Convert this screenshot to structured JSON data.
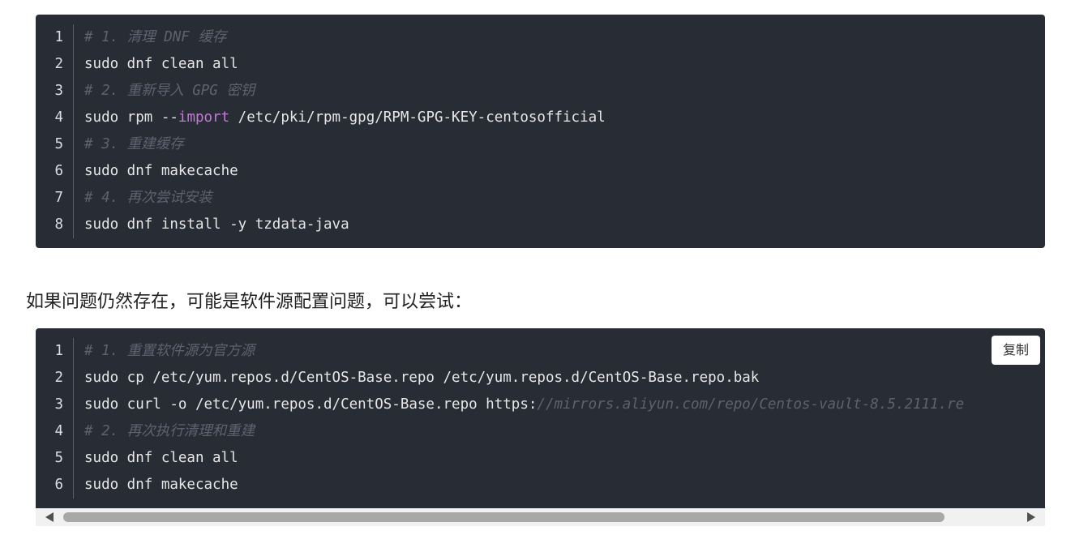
{
  "code_blocks": [
    {
      "lines": [
        {
          "number": "1",
          "parts": [
            {
              "type": "comment",
              "text": "# 1. 清理 DNF 缓存"
            }
          ]
        },
        {
          "number": "2",
          "parts": [
            {
              "type": "plain",
              "text": "sudo dnf clean all"
            }
          ]
        },
        {
          "number": "3",
          "parts": [
            {
              "type": "comment",
              "text": "# 2. 重新导入 GPG 密钥"
            }
          ]
        },
        {
          "number": "4",
          "parts": [
            {
              "type": "plain",
              "text": "sudo rpm --"
            },
            {
              "type": "keyword",
              "text": "import"
            },
            {
              "type": "plain",
              "text": " /etc/pki/rpm-gpg/RPM-GPG-KEY-centosofficial"
            }
          ]
        },
        {
          "number": "5",
          "parts": [
            {
              "type": "comment",
              "text": "# 3. 重建缓存"
            }
          ]
        },
        {
          "number": "6",
          "parts": [
            {
              "type": "plain",
              "text": "sudo dnf makecache"
            }
          ]
        },
        {
          "number": "7",
          "parts": [
            {
              "type": "comment",
              "text": "# 4. 再次尝试安装"
            }
          ]
        },
        {
          "number": "8",
          "parts": [
            {
              "type": "plain",
              "text": "sudo dnf install -y tzdata-java"
            }
          ]
        }
      ]
    },
    {
      "copy_label": "复制",
      "lines": [
        {
          "number": "1",
          "parts": [
            {
              "type": "comment",
              "text": "# 1. 重置软件源为官方源"
            }
          ]
        },
        {
          "number": "2",
          "parts": [
            {
              "type": "plain",
              "text": "sudo cp /etc/yum.repos.d/CentOS-Base.repo /etc/yum.repos.d/CentOS-Base.repo.bak"
            }
          ]
        },
        {
          "number": "3",
          "parts": [
            {
              "type": "plain",
              "text": "sudo curl -o /etc/yum.repos.d/CentOS-Base.repo https:"
            },
            {
              "type": "comment",
              "text": "//mirrors.aliyun.com/repo/Centos-vault-8.5.2111.re"
            }
          ]
        },
        {
          "number": "4",
          "parts": [
            {
              "type": "comment",
              "text": "# 2. 再次执行清理和重建"
            }
          ]
        },
        {
          "number": "5",
          "parts": [
            {
              "type": "plain",
              "text": "sudo dnf clean all"
            }
          ]
        },
        {
          "number": "6",
          "parts": [
            {
              "type": "plain",
              "text": "sudo dnf makecache"
            }
          ]
        }
      ]
    }
  ],
  "paragraph": "如果问题仍然存在，可能是软件源配置问题，可以尝试：",
  "colors": {
    "code_background": "#282c34",
    "comment": "#5c6370",
    "keyword": "#c678dd",
    "code_text": "#e6e6e6"
  },
  "icons": {
    "scroll_left": "triangle-left-icon",
    "scroll_right": "triangle-right-icon"
  }
}
